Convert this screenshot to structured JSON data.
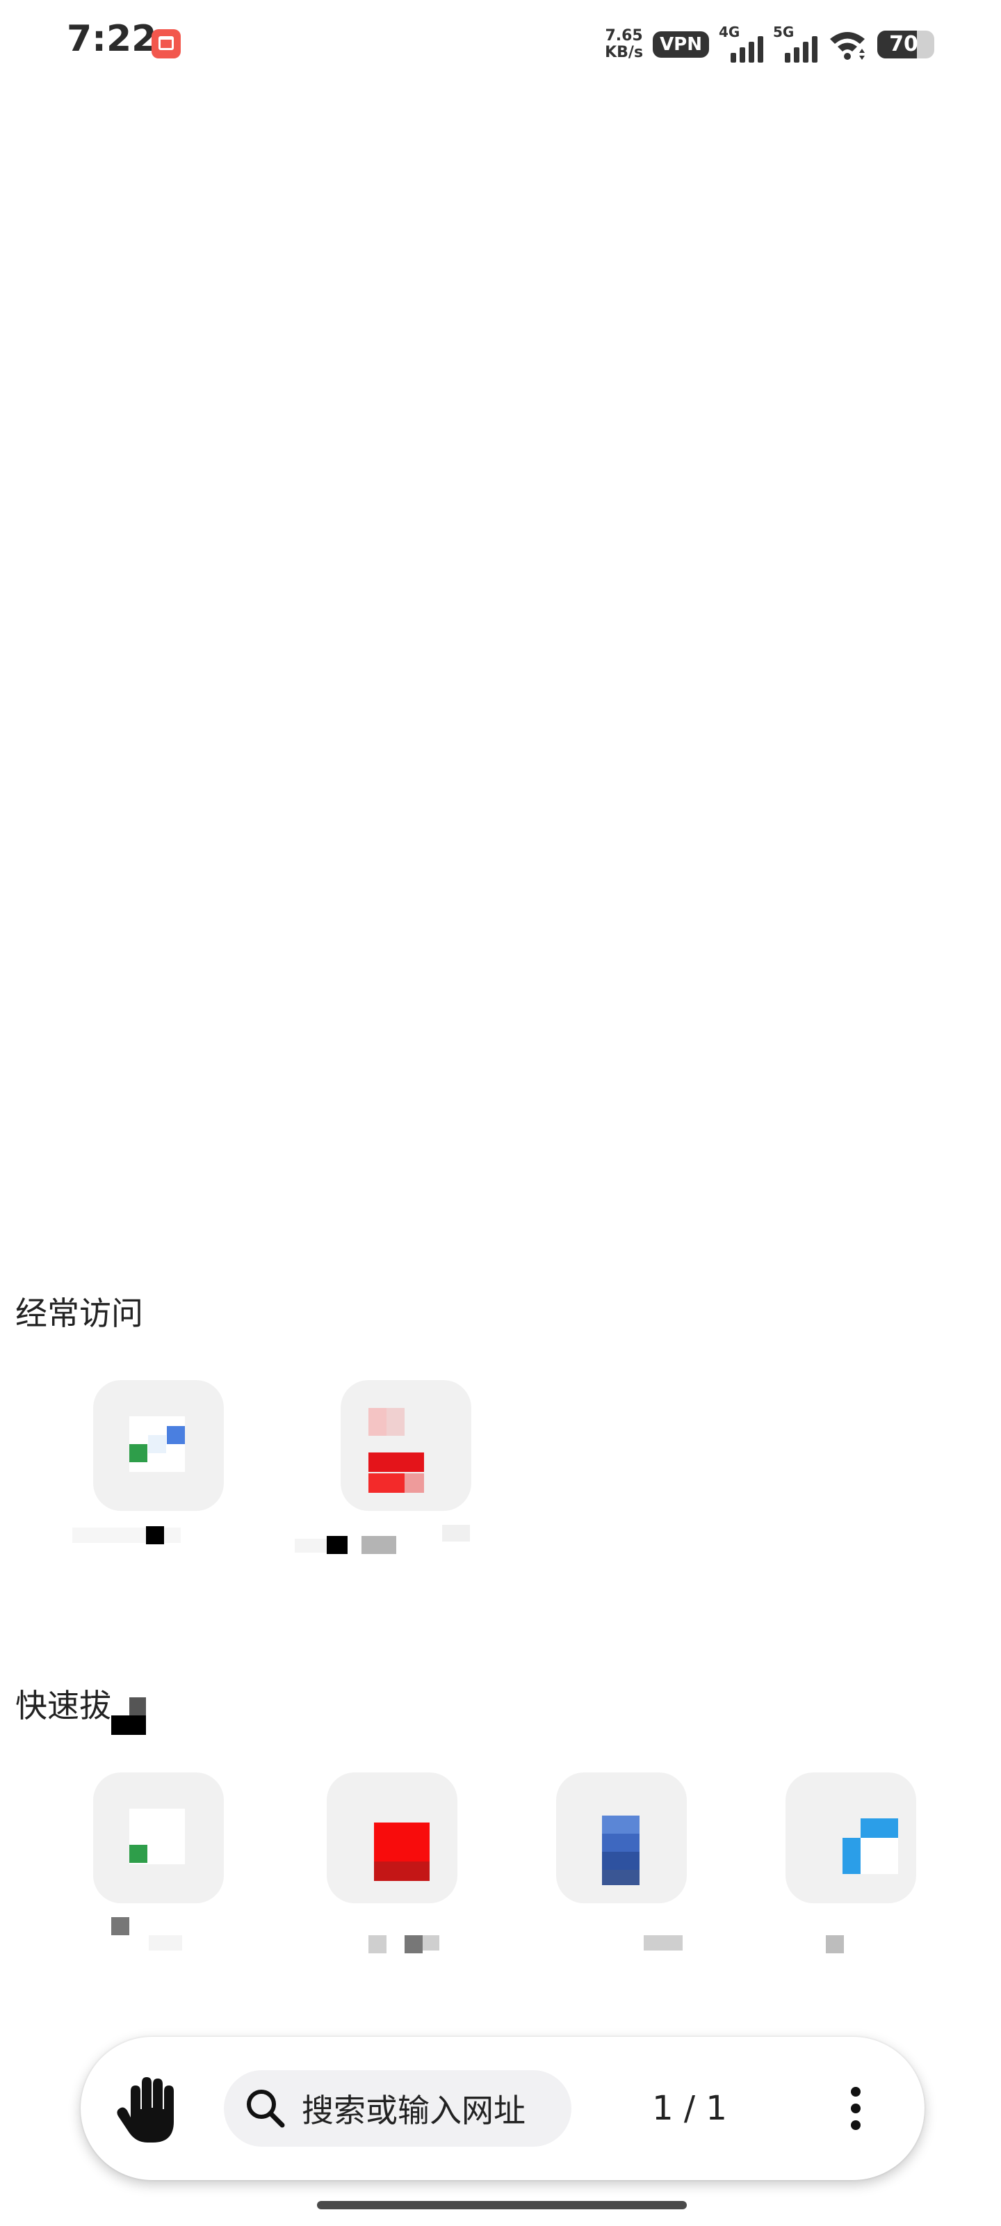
{
  "status_bar": {
    "time": "7:22",
    "net_speed_value": "7.65",
    "net_speed_unit": "KB/s",
    "vpn": "VPN",
    "signal_1": "4G",
    "signal_2": "5G",
    "battery": "70",
    "battery_level_percent": 70,
    "app_icon": "shopping-bag-icon"
  },
  "frequent": {
    "title": "经常访问"
  },
  "shortcuts": {
    "title": "快速拔"
  },
  "toolbar": {
    "search_placeholder": "搜索或输入网址",
    "tab_count": "1 / 1",
    "left_icon": "hand-icon",
    "search_icon": "search-icon",
    "menu_icon": "more-vertical-icon"
  },
  "colors": {
    "tile_bg": "#f1f1f1",
    "toolbar_bg": "#ffffff",
    "search_pill_bg": "#f1f1f3",
    "text": "#222222"
  }
}
